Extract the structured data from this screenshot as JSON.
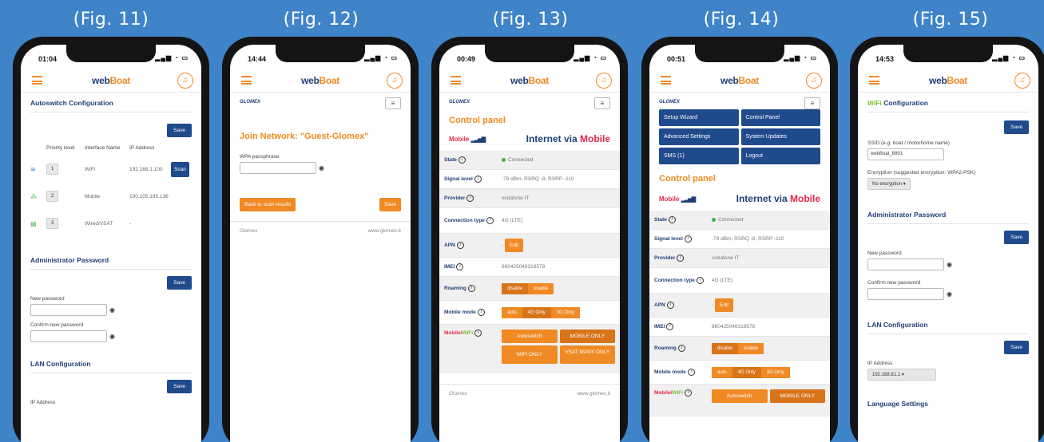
{
  "figures": [
    "(Fig. 11)",
    "(Fig. 12)",
    "(Fig. 13)",
    "(Fig. 14)",
    "(Fig. 15)"
  ],
  "status_times": [
    "01:04",
    "14:44",
    "00:49",
    "00:51",
    "14:53"
  ],
  "brand": {
    "logo_left": "web",
    "logo_right": "Boat"
  },
  "colors": {
    "background": "#3f83c8",
    "orange": "#f08a24",
    "navy": "#1f3f7a",
    "button_blue": "#1f4a8c",
    "mobile_red": "#e3284a",
    "wifi_green": "#7bbf2a"
  },
  "fig11": {
    "section_title": "Autoswitch Configuration",
    "save": "Save",
    "headers": {
      "priority": "Priority level",
      "interface": "Interface Name",
      "ip": "IP Address"
    },
    "rows": [
      {
        "priority": "1",
        "name": "WiFi",
        "ip": "192.168.1.100"
      },
      {
        "priority": "2",
        "name": "Mobile",
        "ip": "100.105.195.136"
      },
      {
        "priority": "3",
        "name": "Wired/VSAT",
        "ip": "-"
      }
    ],
    "scan_button": "Scan",
    "admin_title": "Administrator Password",
    "new_password_label": "New password",
    "confirm_password_label": "Confirm new password",
    "lan_title": "LAN Configuration",
    "ip_address_label": "IP Address"
  },
  "fig12": {
    "brand_small": "GLOMEX",
    "join_title": "Join Network: \"Guest-Glomex\"",
    "wpa_label": "WPA passphrase",
    "back_button": "Back to scan results",
    "save": "Save",
    "footer_left": "Glomex",
    "footer_right": "www.glomex.it"
  },
  "fig13": {
    "brand_small": "GLOMEX",
    "cp_title": "Control panel",
    "mobile_label": "Mobile",
    "internet_via": "Internet via",
    "internet_mode": "Mobile",
    "rows": [
      {
        "key": "State",
        "value": "Connected"
      },
      {
        "key": "Signal level",
        "value": "-79 dBm, RSRQ -8, RSRP -110"
      },
      {
        "key": "Provider",
        "value": "vodafone IT"
      },
      {
        "key": "Connection type",
        "value": "4G (LTE)"
      },
      {
        "key": "APN",
        "value": "-"
      },
      {
        "key": "IMEI",
        "value": "860425048318578"
      },
      {
        "key": "Roaming",
        "value": ""
      },
      {
        "key": "Mobile mode",
        "value": ""
      }
    ],
    "edit": "Edit",
    "roaming_options": [
      "disable",
      "enable"
    ],
    "mode_options": [
      "auto",
      "4G Only",
      "3G Only"
    ],
    "mw_label_mobile": "Mobile/",
    "mw_label_wifi": "WiFi",
    "mw_options": [
      "Autoswitch",
      "MOBILE ONLY",
      "WIFI ONLY",
      "VSAT MANY ONLY"
    ],
    "footer_left": "Glomex",
    "footer_right": "www.glomex.it"
  },
  "fig14": {
    "brand_small": "GLOMEX",
    "nav": [
      "Setup Wizard",
      "Control Panel",
      "Advanced Settings",
      "System Updates",
      "SMS (1)",
      "Logout"
    ],
    "cp_title": "Control panel",
    "mobile_label": "Mobile",
    "internet_via": "Internet via",
    "internet_mode": "Mobile",
    "rows": [
      {
        "key": "State",
        "value": "Connected"
      },
      {
        "key": "Signal level",
        "value": "-79 dBm, RSRQ -8, RSRP -110"
      },
      {
        "key": "Provider",
        "value": "vodafone IT"
      },
      {
        "key": "Connection type",
        "value": "4G (LTE)"
      },
      {
        "key": "APN",
        "value": "-"
      },
      {
        "key": "IMEI",
        "value": "860425048318578"
      },
      {
        "key": "Roaming",
        "value": ""
      },
      {
        "key": "Mobile mode",
        "value": ""
      }
    ],
    "edit": "Edit",
    "roaming_options": [
      "disable",
      "enable"
    ],
    "mode_options": [
      "auto",
      "4G Only",
      "3G Only"
    ],
    "mw_label_mobile": "Mobile/",
    "mw_label_wifi": "WiFi",
    "mw_options": [
      "Autoswitch",
      "MOBILE ONLY"
    ]
  },
  "fig15": {
    "wifi_word": "WiFi",
    "wifi_title_rest": " Configuration",
    "save": "Save",
    "ssid_label": "SSID (e.g. boat / motorhome name)",
    "ssid_value": "webBoat_8891",
    "enc_label": "Encryption (suggested encryption: WPA2-PSK)",
    "enc_value": "No encryption",
    "admin_title": "Administrator Password",
    "new_password_label": "New password",
    "confirm_password_label": "Confirm new password",
    "lan_title": "LAN Configuration",
    "ip_label": "IP Address",
    "ip_value": "192.168.81.1",
    "lang_title": "Language Settings"
  }
}
